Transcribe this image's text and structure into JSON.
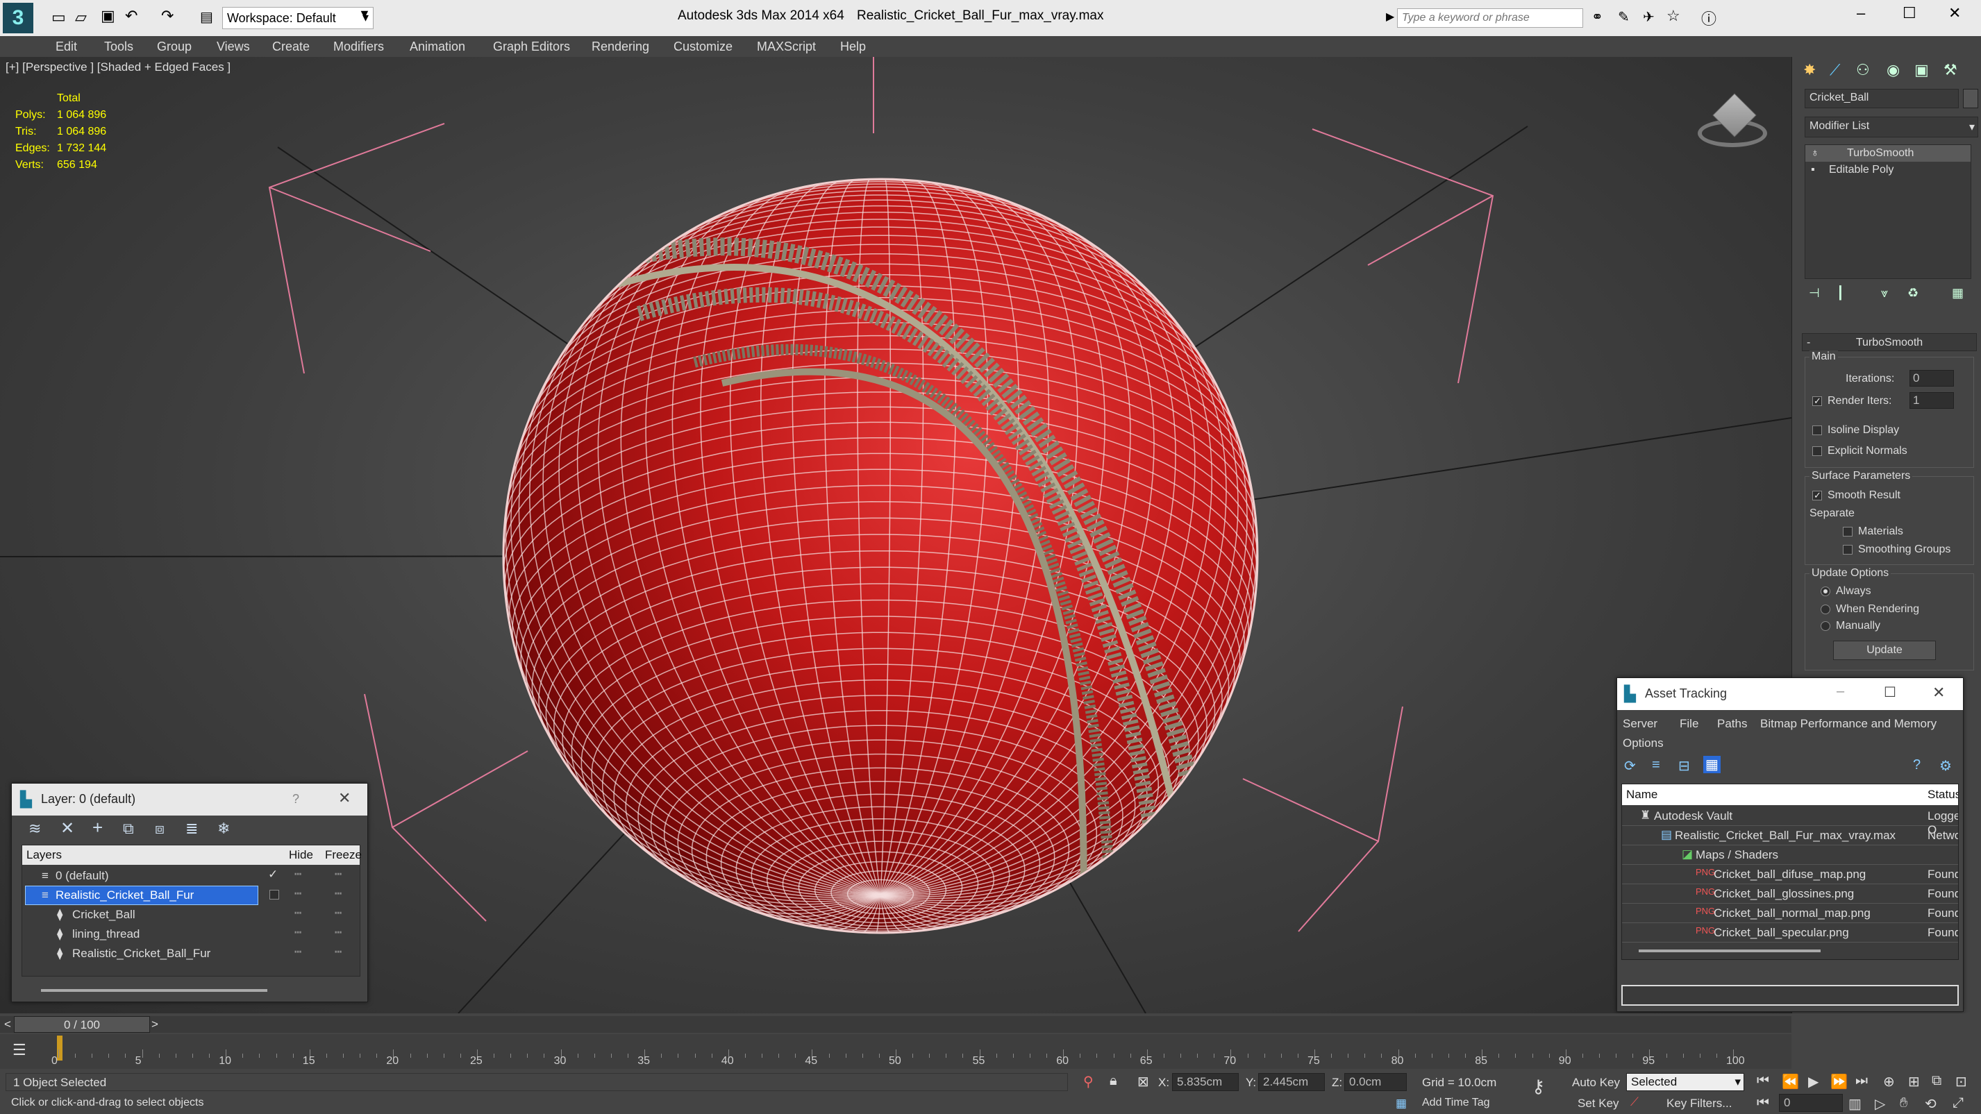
{
  "titlebar": {
    "workspace": "Workspace: Default",
    "app_title": "Autodesk 3ds Max  2014 x64",
    "file_title": "Realistic_Cricket_Ball_Fur_max_vray.max",
    "search_placeholder": "Type a keyword or phrase"
  },
  "menu": [
    "Edit",
    "Tools",
    "Group",
    "Views",
    "Create",
    "Modifiers",
    "Animation",
    "Graph Editors",
    "Rendering",
    "Customize",
    "MAXScript",
    "Help"
  ],
  "viewport": {
    "label": "[+] [Perspective ] [Shaded + Edged Faces ]",
    "stats": {
      "total_label": "Total",
      "polys_label": "Polys:",
      "polys": "1 064 896",
      "tris_label": "Tris:",
      "tris": "1 064 896",
      "edges_label": "Edges:",
      "edges": "1 732 144",
      "verts_label": "Verts:",
      "verts": "656 194"
    }
  },
  "command_panel": {
    "object_name": "Cricket_Ball",
    "modifier_list": "Modifier List",
    "stack": [
      "TurboSmooth",
      "Editable Poly"
    ],
    "rollout_title": "TurboSmooth",
    "main_label": "Main",
    "iterations_label": "Iterations:",
    "iterations": "0",
    "render_iters_label": "Render Iters:",
    "render_iters": "1",
    "isoline": "Isoline Display",
    "explicit_normals": "Explicit Normals",
    "surface_params": "Surface Parameters",
    "smooth_result": "Smooth Result",
    "separate": "Separate",
    "materials": "Materials",
    "smoothing_groups": "Smoothing Groups",
    "update_options": "Update Options",
    "always": "Always",
    "when_rendering": "When Rendering",
    "manually": "Manually",
    "update_button": "Update"
  },
  "layer_dialog": {
    "title": "Layer: 0 (default)",
    "help": "?",
    "col_layers": "Layers",
    "col_hide": "Hide",
    "col_freeze": "Freeze",
    "rows": [
      {
        "name": "0 (default)"
      },
      {
        "name": "Realistic_Cricket_Ball_Fur"
      },
      {
        "name": "Cricket_Ball"
      },
      {
        "name": "lining_thread"
      },
      {
        "name": "Realistic_Cricket_Ball_Fur"
      }
    ]
  },
  "asset_tracking": {
    "title": "Asset Tracking",
    "menu": [
      "Server",
      "File",
      "Paths",
      "Bitmap Performance and Memory"
    ],
    "menu2": "Options",
    "col_name": "Name",
    "col_status": "Status",
    "rows": [
      {
        "name": "Autodesk Vault",
        "status": "Logged O"
      },
      {
        "name": "Realistic_Cricket_Ball_Fur_max_vray.max",
        "status": "Network"
      },
      {
        "name": "Maps / Shaders",
        "status": ""
      },
      {
        "name": "Cricket_ball_difuse_map.png",
        "status": "Found"
      },
      {
        "name": "Cricket_ball_glossines.png",
        "status": "Found"
      },
      {
        "name": "Cricket_ball_normal_map.png",
        "status": "Found"
      },
      {
        "name": "Cricket_ball_specular.png",
        "status": "Found"
      }
    ]
  },
  "timeline": {
    "frame": "0 / 100",
    "ticks": [
      "0",
      "5",
      "10",
      "15",
      "20",
      "25",
      "30",
      "35",
      "40",
      "45",
      "50",
      "55",
      "60",
      "65",
      "70",
      "75",
      "80",
      "85",
      "90",
      "95",
      "100"
    ]
  },
  "status": {
    "selected": "1 Object Selected",
    "prompt": "Click or click-and-drag to select objects",
    "x_label": "X:",
    "x": "5.835cm",
    "y_label": "Y:",
    "y": "2.445cm",
    "z_label": "Z:",
    "z": "0.0cm",
    "grid": "Grid = 10.0cm",
    "auto_key": "Auto Key",
    "set_key": "Set Key",
    "key_mode": "Selected",
    "key_filters": "Key Filters...",
    "add_time_tag": "Add Time Tag",
    "frame_field": "0"
  }
}
